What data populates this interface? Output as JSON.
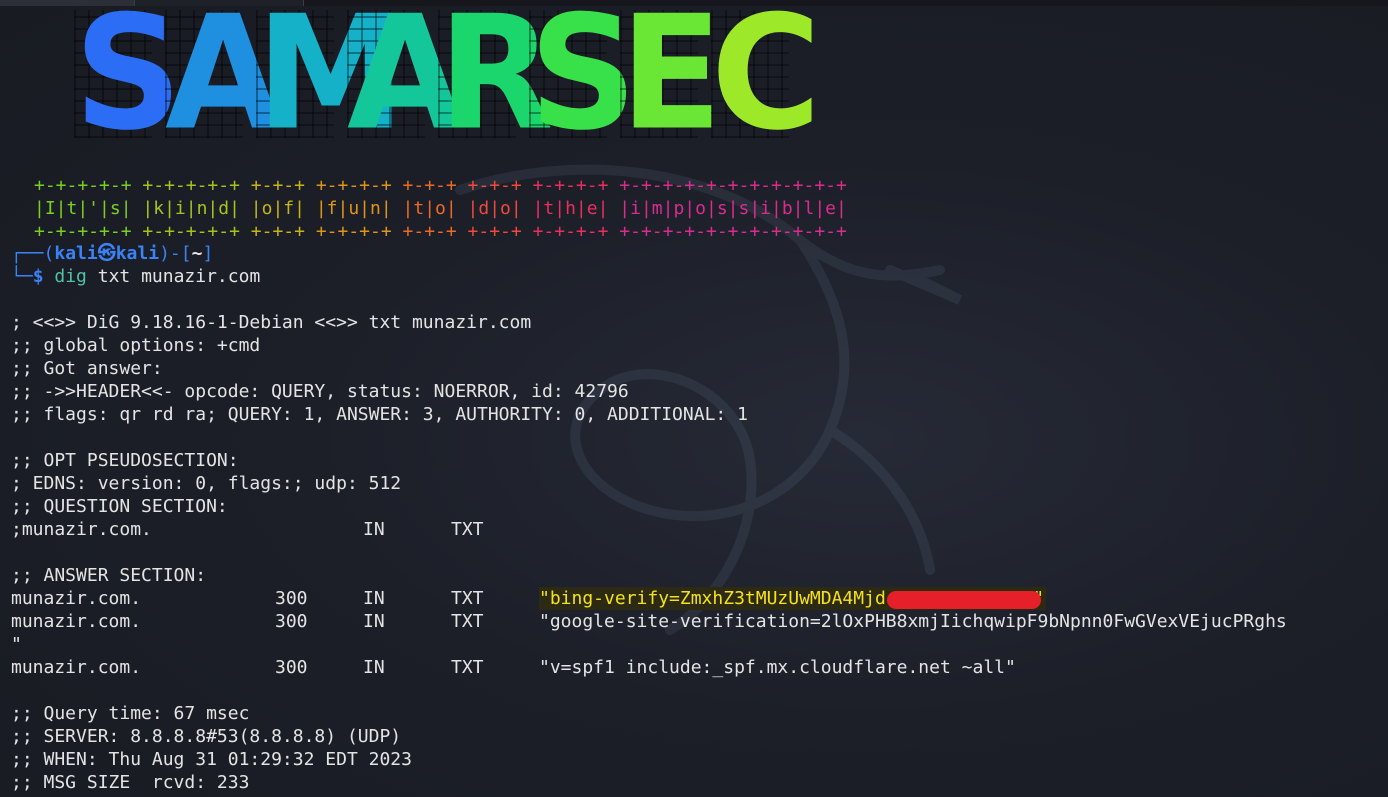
{
  "window": {
    "tabs": [
      {
        "label": ""
      },
      {
        "label": ""
      }
    ]
  },
  "banner": {
    "text": "SAMARSEC",
    "letters": [
      "S",
      "A",
      "M",
      "A",
      "R",
      "S",
      "E",
      "C"
    ],
    "colors": [
      "#2b6ef5",
      "#1f8fe0",
      "#14b1c8",
      "#13c79a",
      "#1ad66c",
      "#38e04a",
      "#6ae634",
      "#9ee82a"
    ]
  },
  "motto": {
    "border": "+-+-+-+-+ +-+-+-+-+ +-+-+ +-+-+-+ +-+-+ +-+-+ +-+-+-+ +-+-+-+-+-+-+-+-+-+-+",
    "words": [
      {
        "text": "|I|t|'|s|",
        "color": "#79d023"
      },
      {
        "text": "|k|i|n|d|",
        "color": "#a8c41b"
      },
      {
        "text": "|o|f|",
        "color": "#c7b417"
      },
      {
        "text": "|f|u|n|",
        "color": "#e09418"
      },
      {
        "text": "|t|o|",
        "color": "#ec6a24"
      },
      {
        "text": "|d|o|",
        "color": "#ef4a3a"
      },
      {
        "text": "|t|h|e|",
        "color": "#ea2f5c"
      },
      {
        "text": "|i|m|p|o|s|s|i|b|l|e|",
        "color": "#d92c8f"
      }
    ],
    "border_segments": [
      {
        "text": "+-+-+-+-+",
        "color": "#79d023"
      },
      {
        "text": "+-+-+-+-+",
        "color": "#a8c41b"
      },
      {
        "text": "+-+-+",
        "color": "#c7b417"
      },
      {
        "text": "+-+-+-+",
        "color": "#e09418"
      },
      {
        "text": "+-+-+",
        "color": "#ec6a24"
      },
      {
        "text": "+-+-+",
        "color": "#ef4a3a"
      },
      {
        "text": "+-+-+-+",
        "color": "#ea2f5c"
      },
      {
        "text": "+-+-+-+-+-+-+-+-+-+-+",
        "color": "#d92c8f"
      }
    ]
  },
  "prompt": {
    "corner_top": "┌──(",
    "user": "kali",
    "symbol": "㉿",
    "host": "kali",
    "mid": ")-[",
    "dir": "~",
    "end": "]",
    "corner_bottom": "└─",
    "dollar": "$",
    "command": "dig",
    "args": " txt munazir.com"
  },
  "output": {
    "header_lines": [
      "; <<>> DiG 9.18.16-1-Debian <<>> txt munazir.com",
      ";; global options: +cmd",
      ";; Got answer:",
      ";; ->>HEADER<<- opcode: QUERY, status: NOERROR, id: 42796",
      ";; flags: qr rd ra; QUERY: 1, ANSWER: 3, AUTHORITY: 0, ADDITIONAL: 1"
    ],
    "opt_lines": [
      ";; OPT PSEUDOSECTION:",
      "; EDNS: version: 0, flags:; udp: 512",
      ";; QUESTION SECTION:"
    ],
    "question": {
      "name": ";munazir.com.",
      "class": "IN",
      "type": "TXT"
    },
    "answer_title": ";; ANSWER SECTION:",
    "answers": [
      {
        "name": "munazir.com.",
        "ttl": "300",
        "class": "IN",
        "type": "TXT",
        "value": "\"bing-verify=ZmxhZ3tMUzUwMDA4Mjd",
        "value_tail": "\"",
        "redacted": true
      },
      {
        "name": "munazir.com.",
        "ttl": "300",
        "class": "IN",
        "type": "TXT",
        "value": "\"google-site-verification=2lOxPHB8xmjIichqwipF9bNpnn0FwGVexVEjucPRghs",
        "wrap": "\""
      },
      {
        "name": "munazir.com.",
        "ttl": "300",
        "class": "IN",
        "type": "TXT",
        "value": "\"v=spf1 include:_spf.mx.cloudflare.net ~all\""
      }
    ],
    "footer_lines": [
      ";; Query time: 67 msec",
      ";; SERVER: 8.8.8.8#53(8.8.8.8) (UDP)",
      ";; WHEN: Thu Aug 31 01:29:32 EDT 2023",
      ";; MSG SIZE  rcvd: 233"
    ]
  },
  "colors": {
    "background": "#1b1e26",
    "text": "#e4e4e4",
    "prompt_blue": "#3b82f6",
    "command_green": "#4ec3a6",
    "highlight_yellow": "#f5e21b",
    "redaction_red": "#e5202a"
  }
}
